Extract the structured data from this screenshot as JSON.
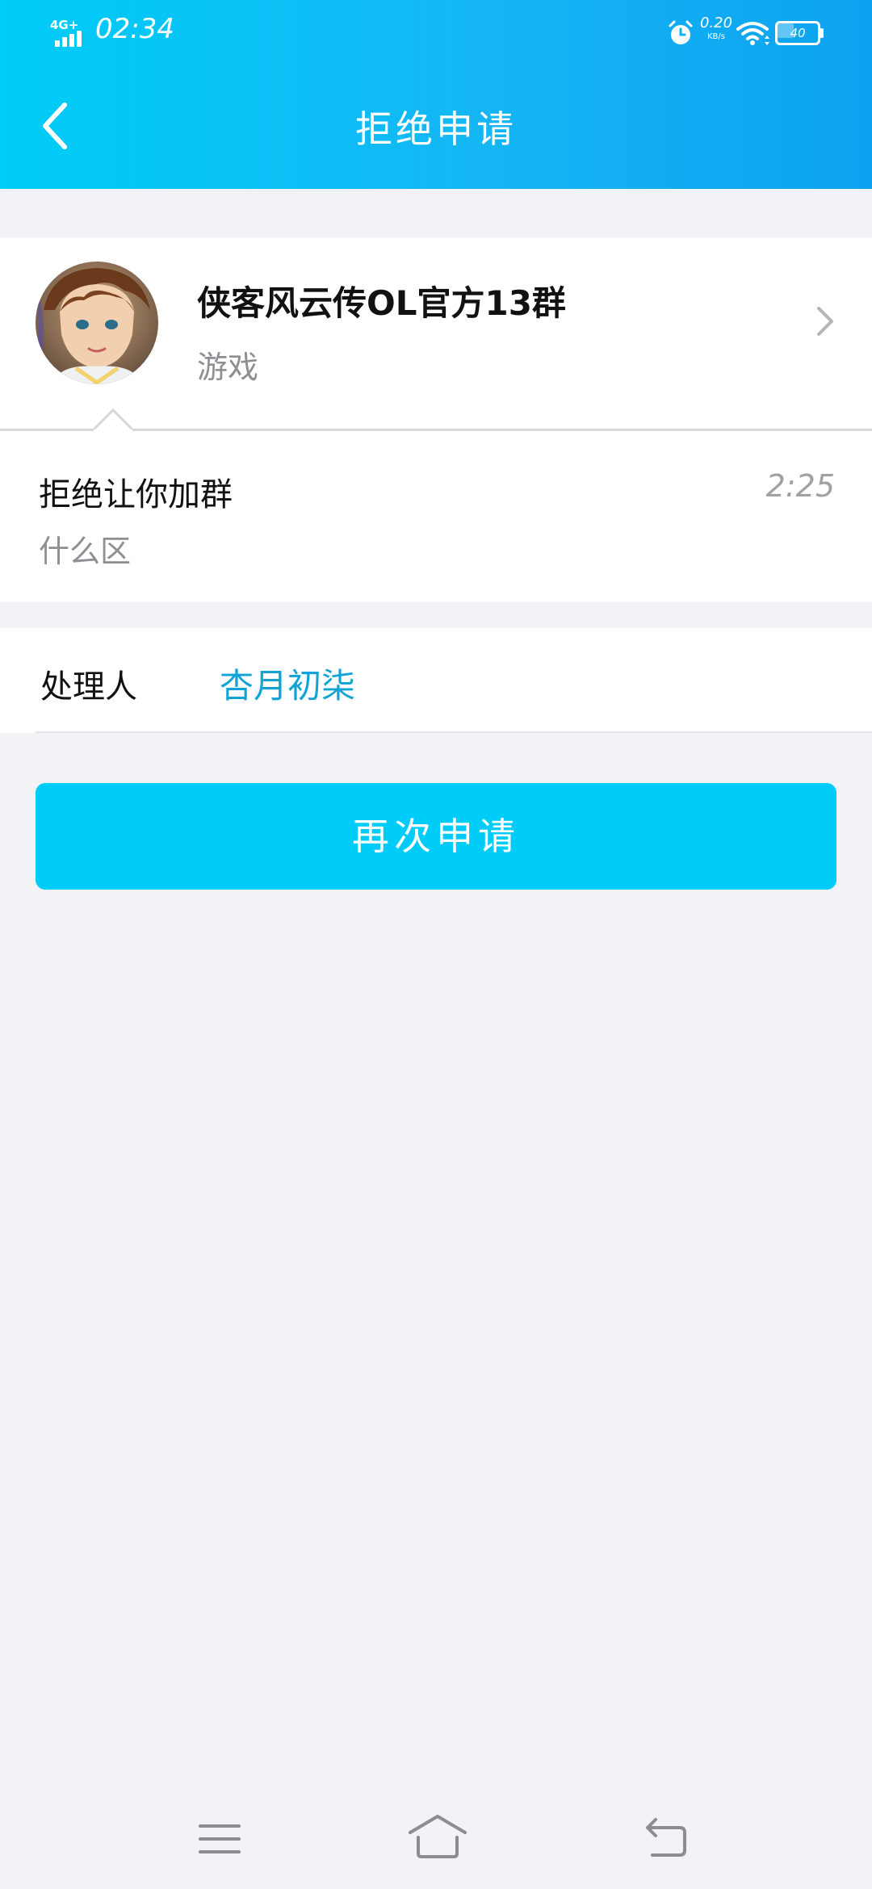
{
  "status_bar": {
    "network": "4G+",
    "time": "02:34",
    "net_speed_value": "0.20",
    "net_speed_unit": "KB/s",
    "battery_level": "40"
  },
  "header": {
    "title": "拒绝申请",
    "back_icon": "chevron-left-icon"
  },
  "group": {
    "name": "侠客风云传OL官方13群",
    "category": "游戏",
    "avatar_icon": "group-avatar",
    "chevron_icon": "chevron-right-icon"
  },
  "message": {
    "title": "拒绝让你加群",
    "time": "2:25",
    "body": "什么区"
  },
  "handler": {
    "label": "处理人",
    "name": "杏月初柒"
  },
  "actions": {
    "reapply_label": "再次申请"
  },
  "nav": {
    "menu_icon": "menu-icon",
    "home_icon": "home-icon",
    "back_icon": "back-icon"
  },
  "colors": {
    "header_gradient_start": "#00cdf8",
    "header_gradient_end": "#0da2f0",
    "button_bg": "#00ccfa",
    "link": "#12a3d6",
    "page_bg": "#f2f3f7"
  }
}
